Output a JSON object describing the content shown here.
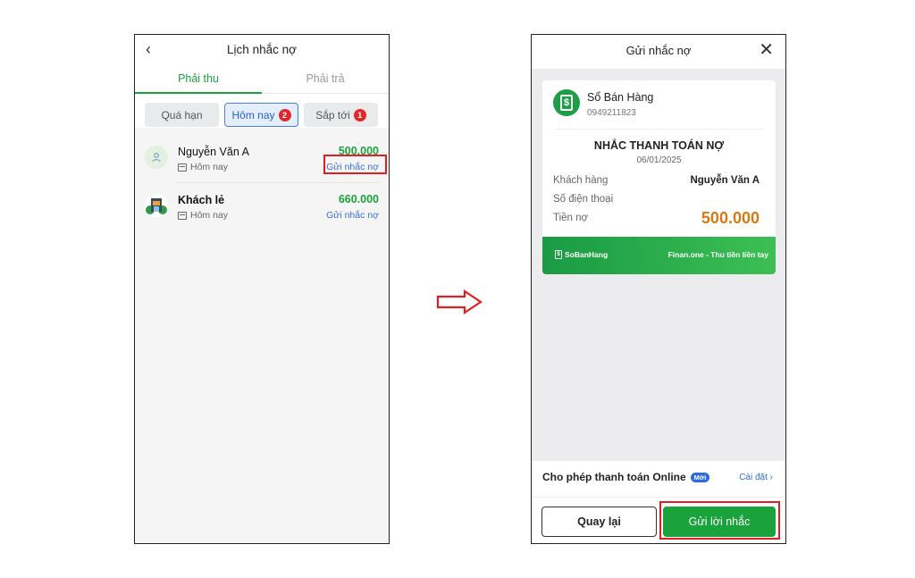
{
  "screen1": {
    "title": "Lịch nhắc nợ",
    "back_icon": "chevron-left-icon",
    "tabs": [
      {
        "label": "Phải thu",
        "active": true
      },
      {
        "label": "Phải trả",
        "active": false
      }
    ],
    "filters": [
      {
        "label": "Quá hạn",
        "badge": ""
      },
      {
        "label": "Hôm nay",
        "badge": "2",
        "selected": true
      },
      {
        "label": "Sắp tới",
        "badge": "1"
      }
    ],
    "rows": [
      {
        "name": "Nguyễn Văn A",
        "date": "Hôm nay",
        "amount": "500.000",
        "action": "Gửi nhắc nợ"
      },
      {
        "name": "Khách lẻ",
        "date": "Hôm nay",
        "amount": "660.000",
        "action": "Gửi nhắc nợ"
      }
    ]
  },
  "screen2": {
    "title": "Gửi nhắc nợ",
    "close_icon": "close-icon",
    "card": {
      "shop_name": "Sổ Bán Hàng",
      "shop_phone": "0949211823",
      "heading": "NHẮC THANH TOÁN NỢ",
      "date": "06/01/2025",
      "customer_label": "Khách hàng",
      "customer_value": "Nguyễn Văn A",
      "phone_label": "Số điện thoại",
      "phone_value": "",
      "debt_label": "Tiền nợ",
      "debt_value": "500.000",
      "footer_logo": "SoBanHang",
      "footer_right": "Finan.one - Thu tiền liền tay"
    },
    "online": {
      "label": "Cho phép thanh toán Online",
      "badge": "Mới",
      "settings": "Cài đặt"
    },
    "buttons": {
      "back": "Quay lại",
      "send": "Gửi lời nhắc"
    }
  },
  "colors": {
    "accent_green": "#1aa33c",
    "link_blue": "#3a6fd8",
    "highlight_red": "#e02020",
    "debt_orange": "#d57b12"
  }
}
